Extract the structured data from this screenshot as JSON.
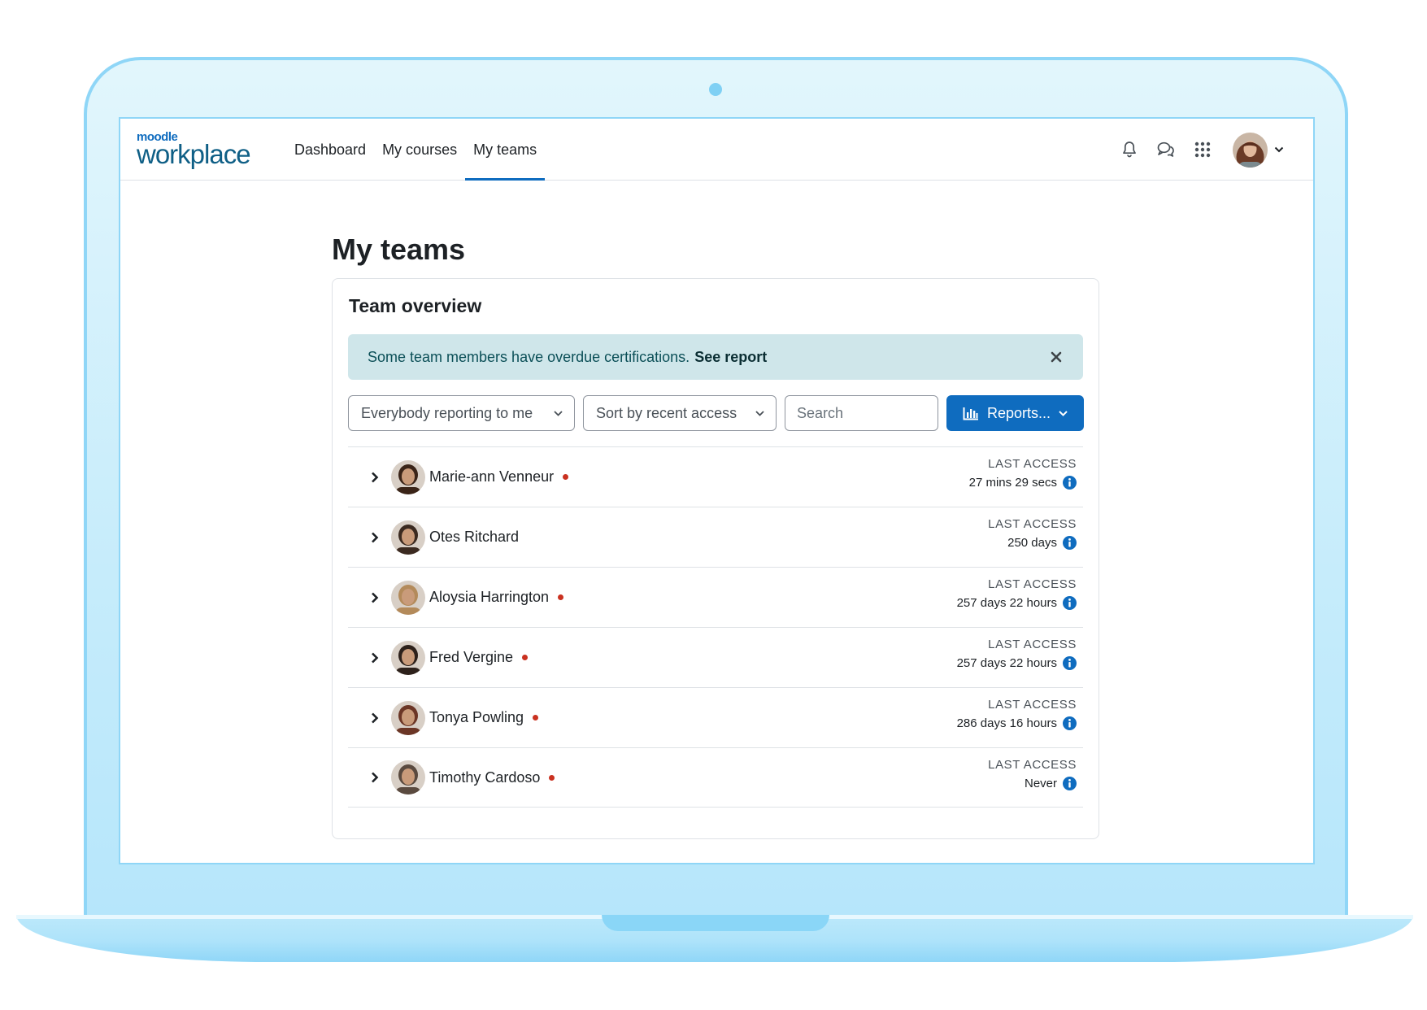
{
  "logo": {
    "top": "moodle",
    "main": "workplace"
  },
  "nav": {
    "links": [
      {
        "label": "Dashboard"
      },
      {
        "label": "My courses"
      },
      {
        "label": "My teams"
      }
    ]
  },
  "page": {
    "title": "My teams"
  },
  "card": {
    "title": "Team overview",
    "alert": {
      "message": "Some team members have overdue certifications.",
      "link": "See report"
    },
    "controls": {
      "filter_value": "Everybody reporting to me",
      "sort_value": "Sort by recent access",
      "search_placeholder": "Search",
      "reports_label": "Reports..."
    },
    "members": [
      {
        "name": "Marie-ann Venneur",
        "overdue": true,
        "access_label": "LAST ACCESS",
        "access_value": "27 mins 29 secs",
        "avatar_color": "#3a2418"
      },
      {
        "name": "Otes Ritchard",
        "overdue": false,
        "access_label": "LAST ACCESS",
        "access_value": "250 days",
        "avatar_color": "#3b2a20"
      },
      {
        "name": "Aloysia Harrington",
        "overdue": true,
        "access_label": "LAST ACCESS",
        "access_value": "257 days 22 hours",
        "avatar_color": "#b38a5a"
      },
      {
        "name": "Fred Vergine",
        "overdue": true,
        "access_label": "LAST ACCESS",
        "access_value": "257 days 22 hours",
        "avatar_color": "#2d211b"
      },
      {
        "name": "Tonya Powling",
        "overdue": true,
        "access_label": "LAST ACCESS",
        "access_value": "286 days 16 hours",
        "avatar_color": "#6b3626"
      },
      {
        "name": "Timothy Cardoso",
        "overdue": true,
        "access_label": "LAST ACCESS",
        "access_value": "Never",
        "avatar_color": "#5a4a3f"
      }
    ]
  },
  "colors": {
    "brand": "#0f6cbf",
    "alert_bg": "#cfe6ea",
    "overdue_dot": "#ca3120",
    "info": "#0f6cbf"
  }
}
